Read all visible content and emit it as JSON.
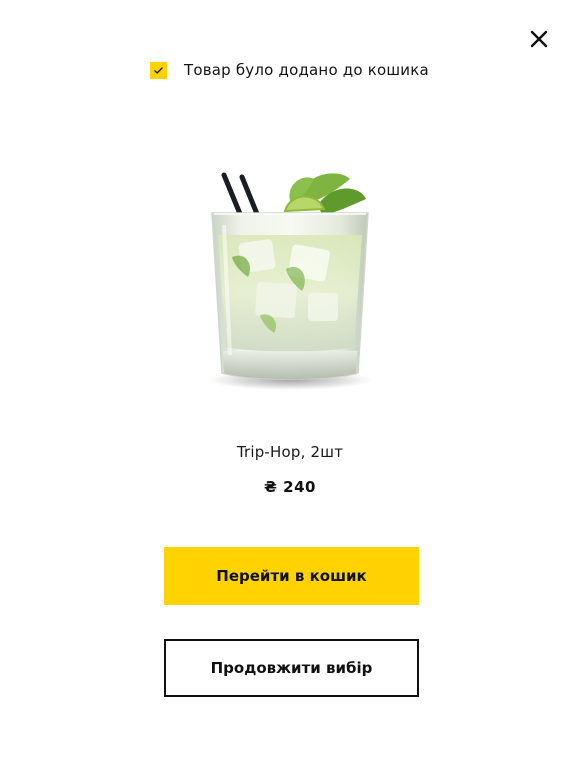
{
  "modal": {
    "close_icon": "close-icon",
    "notice": {
      "icon": "checkmark-icon",
      "text": "Товар було додано до кошика"
    },
    "product": {
      "image_icon": "cocktail-glass-image",
      "name": "Trip-Hop, 2шт",
      "price": "₴ 240"
    },
    "buttons": {
      "go_to_cart": "Перейти в кошик",
      "continue_shopping": "Продовжити вибір"
    },
    "colors": {
      "accent": "#ffd200",
      "text": "#111111",
      "background": "#ffffff"
    }
  }
}
